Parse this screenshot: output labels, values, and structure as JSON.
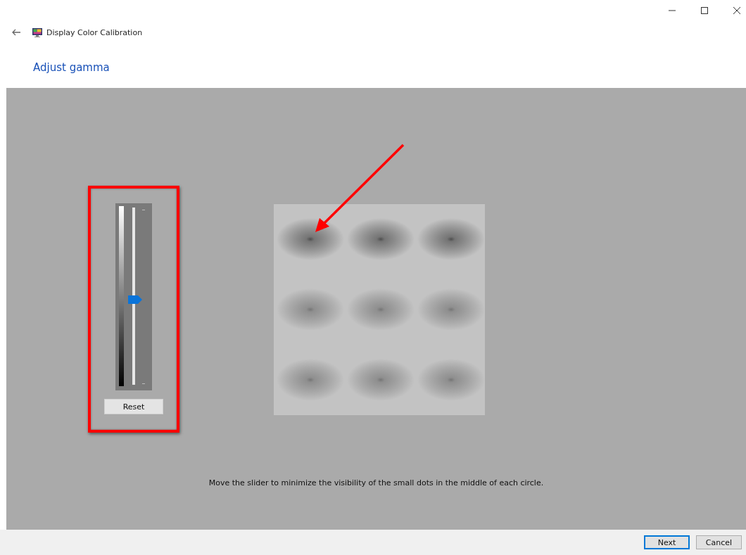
{
  "window": {
    "title": "Display Color Calibration"
  },
  "heading": "Adjust gamma",
  "gamma_slider": {
    "level": 0.48
  },
  "reset_button": "Reset",
  "instruction": "Move the slider to minimize the visibility of the small dots in the middle of each circle.",
  "buttons": [
    {
      "label": "Next",
      "default": true
    },
    {
      "label": "Cancel",
      "default": false
    }
  ]
}
